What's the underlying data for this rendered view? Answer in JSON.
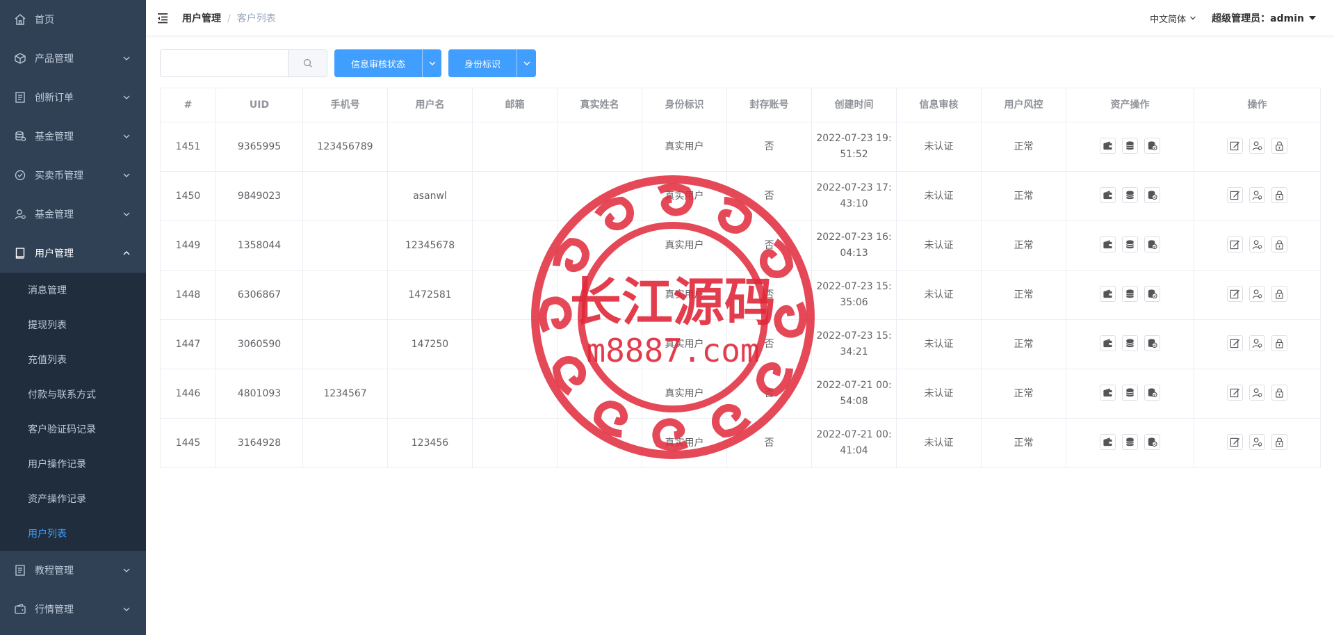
{
  "sidebar": {
    "items": [
      {
        "label": "首页",
        "icon": "home-icon",
        "has_arrow": false
      },
      {
        "label": "产品管理",
        "icon": "cube-icon",
        "has_arrow": true
      },
      {
        "label": "创新订单",
        "icon": "document-icon",
        "has_arrow": true
      },
      {
        "label": "基金管理",
        "icon": "database-icon",
        "has_arrow": true
      },
      {
        "label": "买卖币管理",
        "icon": "check-circle-icon",
        "has_arrow": true
      },
      {
        "label": "基金管理",
        "icon": "user-settings-icon",
        "has_arrow": true
      },
      {
        "label": "用户管理",
        "icon": "notebook-icon",
        "has_arrow": true,
        "expanded": true
      }
    ],
    "subitems": [
      {
        "label": "消息管理"
      },
      {
        "label": "提现列表"
      },
      {
        "label": "充值列表"
      },
      {
        "label": "付款与联系方式"
      },
      {
        "label": "客户验证码记录"
      },
      {
        "label": "用户操作记录"
      },
      {
        "label": "资产操作记录"
      },
      {
        "label": "用户列表",
        "current": true
      }
    ],
    "bottom_items": [
      {
        "label": "教程管理",
        "icon": "document-icon"
      },
      {
        "label": "行情管理",
        "icon": "wallet-icon"
      }
    ]
  },
  "header": {
    "breadcrumb": [
      "用户管理",
      "客户列表"
    ],
    "breadcrumb_sep": "/",
    "language": "中文简体",
    "admin_label": "超级管理员：admin"
  },
  "toolbar": {
    "search_placeholder": "",
    "filter_audit_label": "信息审核状态",
    "filter_identity_label": "身份标识"
  },
  "table": {
    "columns": [
      "#",
      "UID",
      "手机号",
      "用户名",
      "邮箱",
      "真实姓名",
      "身份标识",
      "封存账号",
      "创建时间",
      "信息审核",
      "用户风控",
      "资产操作",
      "操作"
    ],
    "rows": [
      {
        "id": "1451",
        "uid": "9365995",
        "phone": "123456789",
        "username": "",
        "email": "",
        "realname": "",
        "identity": "真实用户",
        "sealed": "否",
        "created": "2022-07-23 19:51:52",
        "audit": "未认证",
        "risk": "正常"
      },
      {
        "id": "1450",
        "uid": "9849023",
        "phone": "",
        "username": "asanwl",
        "email": "",
        "realname": "",
        "identity": "真实用户",
        "sealed": "否",
        "created": "2022-07-23 17:43:10",
        "audit": "未认证",
        "risk": "正常"
      },
      {
        "id": "1449",
        "uid": "1358044",
        "phone": "",
        "username": "12345678",
        "email": "",
        "realname": "",
        "identity": "真实用户",
        "sealed": "否",
        "created": "2022-07-23 16:04:13",
        "audit": "未认证",
        "risk": "正常"
      },
      {
        "id": "1448",
        "uid": "6306867",
        "phone": "",
        "username": "1472581",
        "email": "",
        "realname": "",
        "identity": "真实用户",
        "sealed": "否",
        "created": "2022-07-23 15:35:06",
        "audit": "未认证",
        "risk": "正常"
      },
      {
        "id": "1447",
        "uid": "3060590",
        "phone": "",
        "username": "147250",
        "email": "",
        "realname": "",
        "identity": "真实用户",
        "sealed": "否",
        "created": "2022-07-23 15:34:21",
        "audit": "未认证",
        "risk": "正常"
      },
      {
        "id": "1446",
        "uid": "4801093",
        "phone": "1234567",
        "username": "",
        "email": "",
        "realname": "",
        "identity": "真实用户",
        "sealed": "否",
        "created": "2022-07-21 00:54:08",
        "audit": "未认证",
        "risk": "正常"
      },
      {
        "id": "1445",
        "uid": "3164928",
        "phone": "",
        "username": "123456",
        "email": "",
        "realname": "",
        "identity": "真实用户",
        "sealed": "否",
        "created": "2022-07-21 00:41:04",
        "audit": "未认证",
        "risk": "正常"
      }
    ],
    "asset_ops_icons": [
      "wallet-icon",
      "coins-icon",
      "coins-check-icon"
    ],
    "row_ops_icons": [
      "edit-icon",
      "user-settings-icon",
      "lock-icon"
    ]
  },
  "watermark": {
    "title": "长江源码",
    "url": "m8887.com",
    "color": "#e0283a"
  },
  "colors": {
    "sidebar_bg": "#304156",
    "submenu_bg": "#1f2d3d",
    "primary": "#409EFF"
  }
}
